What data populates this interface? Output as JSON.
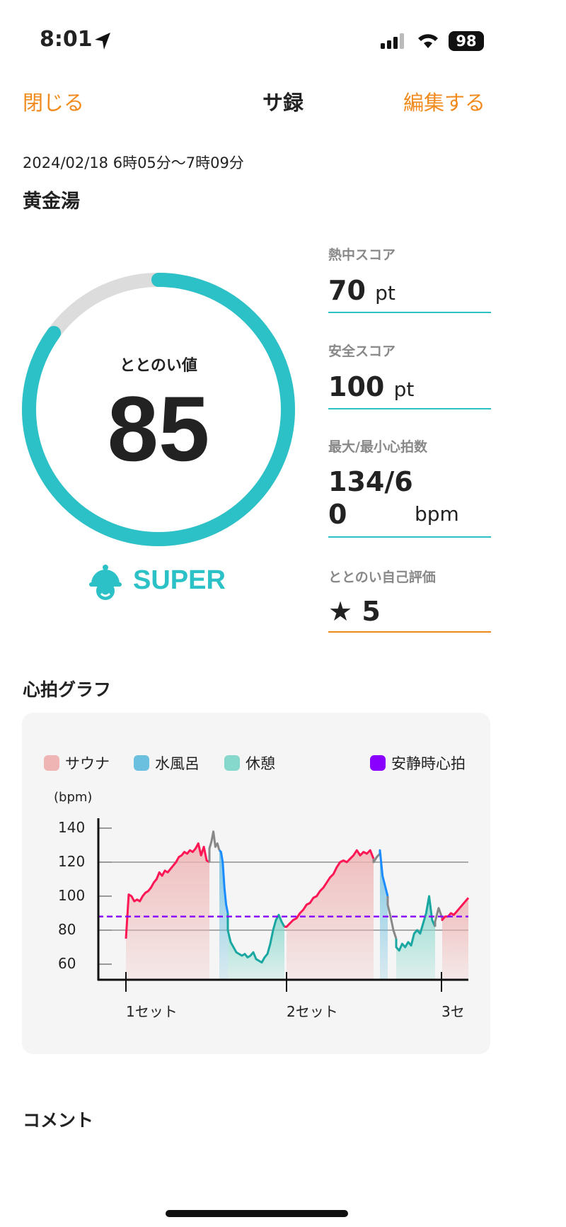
{
  "status": {
    "time": "8:01",
    "battery": "98",
    "icons": [
      "location-arrow-icon",
      "signal-icon",
      "wifi-icon",
      "battery-icon"
    ]
  },
  "header": {
    "close": "閉じる",
    "title": "サ録",
    "edit": "編集する",
    "accent": "#f08a1c"
  },
  "session": {
    "datetime": "2024/02/18 6時05分〜7時09分",
    "facility": "黄金湯"
  },
  "gauge": {
    "label": "ととのい値",
    "value": "85",
    "percent": 85,
    "rank": "SUPER",
    "color": "#2bc1c7"
  },
  "stats": [
    {
      "label": "熱中スコア",
      "value": "70",
      "unit": "pt"
    },
    {
      "label": "安全スコア",
      "value": "100",
      "unit": "pt"
    },
    {
      "label": "最大/最小心拍数",
      "value": "134/6",
      "value2": "0",
      "unit": "bpm"
    },
    {
      "label": "ととのい自己評価",
      "value": "5",
      "icon": "star-icon"
    }
  ],
  "graph_title": "心拍グラフ",
  "comment_title": "コメント",
  "chart_data": {
    "type": "line",
    "ylabel": "(bpm)",
    "yticks": [
      140,
      120,
      100,
      80,
      60
    ],
    "ylim": [
      51,
      145
    ],
    "xticks": [
      "1セット",
      "2セット",
      "3セ"
    ],
    "grid": "y at 80,120",
    "legend_placement": "top",
    "legend": [
      {
        "name": "サウナ",
        "color": "#efb4b4"
      },
      {
        "name": "水風呂",
        "color": "#6bbfdf"
      },
      {
        "name": "休憩",
        "color": "#86d8cc"
      },
      {
        "name": "安静時心拍",
        "color": "#8a00ff"
      }
    ],
    "resting_hr": 88,
    "phases": [
      {
        "type": "sauna",
        "values": [
          75,
          101,
          100,
          97,
          98,
          97,
          100,
          102,
          103,
          105,
          108,
          110,
          114,
          112,
          115,
          114,
          116,
          118,
          120,
          123,
          124,
          126,
          125,
          127,
          126,
          128,
          131,
          124,
          129,
          121,
          120
        ]
      },
      {
        "type": "transition",
        "values": [
          128,
          132,
          138,
          129,
          131,
          127
        ]
      },
      {
        "type": "cold",
        "values": [
          127,
          126,
          120,
          105,
          95,
          90
        ]
      },
      {
        "type": "rest",
        "values": [
          80,
          73,
          70,
          67,
          66,
          65,
          66,
          64,
          65,
          67,
          63,
          62,
          61,
          64,
          66,
          72,
          80,
          86,
          89,
          85,
          82
        ]
      },
      {
        "type": "sauna",
        "values": [
          82,
          84,
          86,
          87,
          90,
          92,
          95,
          96,
          99,
          100,
          103,
          105,
          108,
          111,
          113,
          117,
          120,
          121,
          120,
          122,
          124,
          127,
          124,
          126,
          125,
          127,
          122
        ]
      },
      {
        "type": "transition",
        "values": [
          120,
          123,
          125
        ]
      },
      {
        "type": "cold",
        "values": [
          127,
          112,
          106,
          100
        ]
      },
      {
        "type": "transition",
        "values": [
          95,
          88,
          80,
          75
        ]
      },
      {
        "type": "rest",
        "values": [
          70,
          68,
          72,
          70,
          73,
          71,
          78,
          80,
          78,
          84,
          90,
          100,
          86,
          82
        ]
      },
      {
        "type": "transition",
        "values": [
          85,
          93,
          87
        ]
      },
      {
        "type": "sauna",
        "values": [
          86,
          88,
          88,
          90,
          89,
          91,
          93,
          95,
          97,
          99
        ]
      }
    ],
    "line_colors": {
      "sauna": "#ff1654",
      "cold": "#1a8cff",
      "rest": "#1aa7a2",
      "transition": "#888888"
    }
  }
}
